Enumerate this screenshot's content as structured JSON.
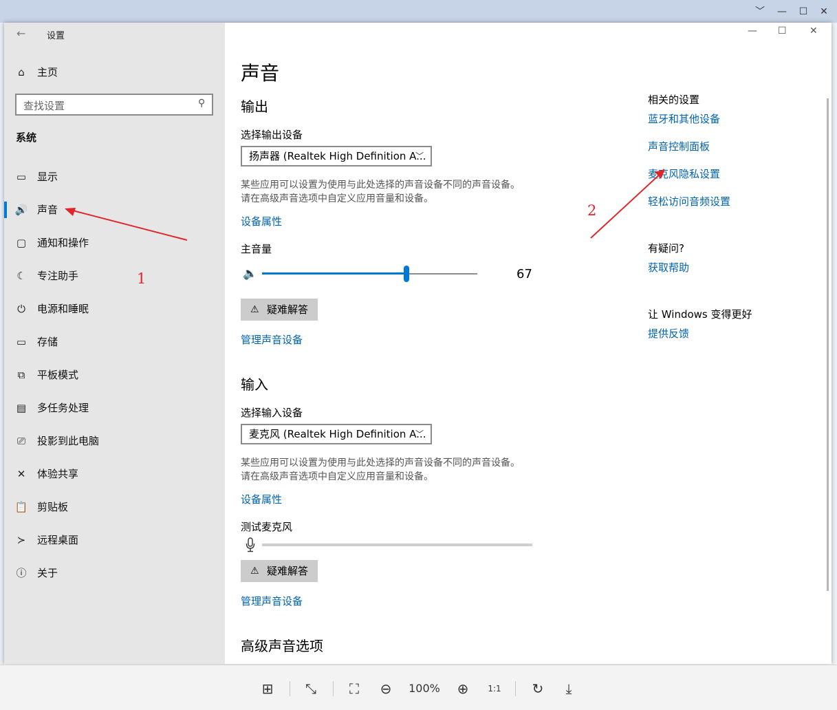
{
  "viewer": {
    "controls": [
      "﹀",
      "—",
      "☐",
      "✕"
    ],
    "toolbar": {
      "zoom": "100%"
    }
  },
  "window": {
    "title": "设置",
    "back_icon": "←",
    "controls": [
      "—",
      "☐",
      "✕"
    ]
  },
  "sidebar": {
    "home": "主页",
    "search_placeholder": "查找设置",
    "section": "系统",
    "items": [
      {
        "label": "显示",
        "icon": "▭"
      },
      {
        "label": "声音",
        "icon": "🔊"
      },
      {
        "label": "通知和操作",
        "icon": "▢"
      },
      {
        "label": "专注助手",
        "icon": "☾"
      },
      {
        "label": "电源和睡眠",
        "icon": "⏻"
      },
      {
        "label": "存储",
        "icon": "▭"
      },
      {
        "label": "平板模式",
        "icon": "⧉"
      },
      {
        "label": "多任务处理",
        "icon": "▤"
      },
      {
        "label": "投影到此电脑",
        "icon": "⎚"
      },
      {
        "label": "体验共享",
        "icon": "✕"
      },
      {
        "label": "剪贴板",
        "icon": "📋"
      },
      {
        "label": "远程桌面",
        "icon": "≻"
      },
      {
        "label": "关于",
        "icon": "ⓘ"
      }
    ],
    "selected_index": 1
  },
  "main": {
    "title": "声音",
    "output": {
      "heading": "输出",
      "select_label": "选择输出设备",
      "device": "扬声器 (Realtek High Definition A...",
      "desc_1": "某些应用可以设置为使用与此处选择的声音设备不同的声音设备。",
      "desc_2": "请在高级声音选项中自定义应用音量和设备。",
      "properties_link": "设备属性",
      "volume_label": "主音量",
      "volume_value": "67",
      "volume_level": 0.67,
      "troubleshoot": "疑难解答",
      "manage_link": "管理声音设备"
    },
    "input": {
      "heading": "输入",
      "select_label": "选择输入设备",
      "device": "麦克风 (Realtek High Definition A...",
      "desc_1": "某些应用可以设置为使用与此处选择的声音设备不同的声音设备。",
      "desc_2": "请在高级声音选项中自定义应用音量和设备。",
      "properties_link": "设备属性",
      "test_label": "测试麦克风",
      "troubleshoot": "疑难解答",
      "manage_link": "管理声音设备"
    },
    "advanced_heading": "高级声音选项"
  },
  "related": {
    "heading": "相关的设置",
    "links": [
      "蓝牙和其他设备",
      "声音控制面板",
      "麦克风隐私设置",
      "轻松访问音频设置"
    ],
    "question_heading": "有疑问?",
    "help_link": "获取帮助",
    "feedback_heading": "让 Windows 变得更好",
    "feedback_link": "提供反馈"
  },
  "annotations": {
    "num1": "1",
    "num2": "2",
    "color": "#e0252b"
  }
}
